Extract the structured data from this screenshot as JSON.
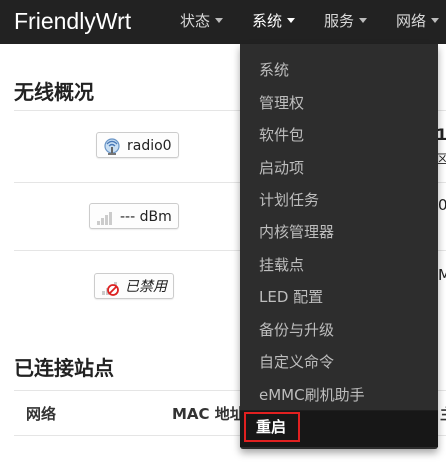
{
  "navbar": {
    "brand": "FriendlyWrt",
    "menus": [
      {
        "label": "状态"
      },
      {
        "label": "系统"
      },
      {
        "label": "服务"
      },
      {
        "label": "网络"
      }
    ]
  },
  "wireless": {
    "title": "无线概况",
    "rows": [
      {
        "label": "radio0",
        "icon": "wireless-radio-icon",
        "right": "1",
        "right2": "区"
      },
      {
        "label": "--- dBm",
        "icon": "signal-strength-icon",
        "right": "0"
      },
      {
        "label": "已禁用",
        "icon": "disabled-signal-icon",
        "right": "M"
      }
    ]
  },
  "stations": {
    "title": "已连接站点",
    "columns": [
      "网络",
      "MAC 地址",
      "主"
    ]
  },
  "system_menu": {
    "items": [
      "系统",
      "管理权",
      "软件包",
      "启动项",
      "计划任务",
      "内核管理器",
      "挂载点",
      "LED 配置",
      "备份与升级",
      "自定义命令",
      "eMMC刷机助手"
    ],
    "active": "重启"
  }
}
